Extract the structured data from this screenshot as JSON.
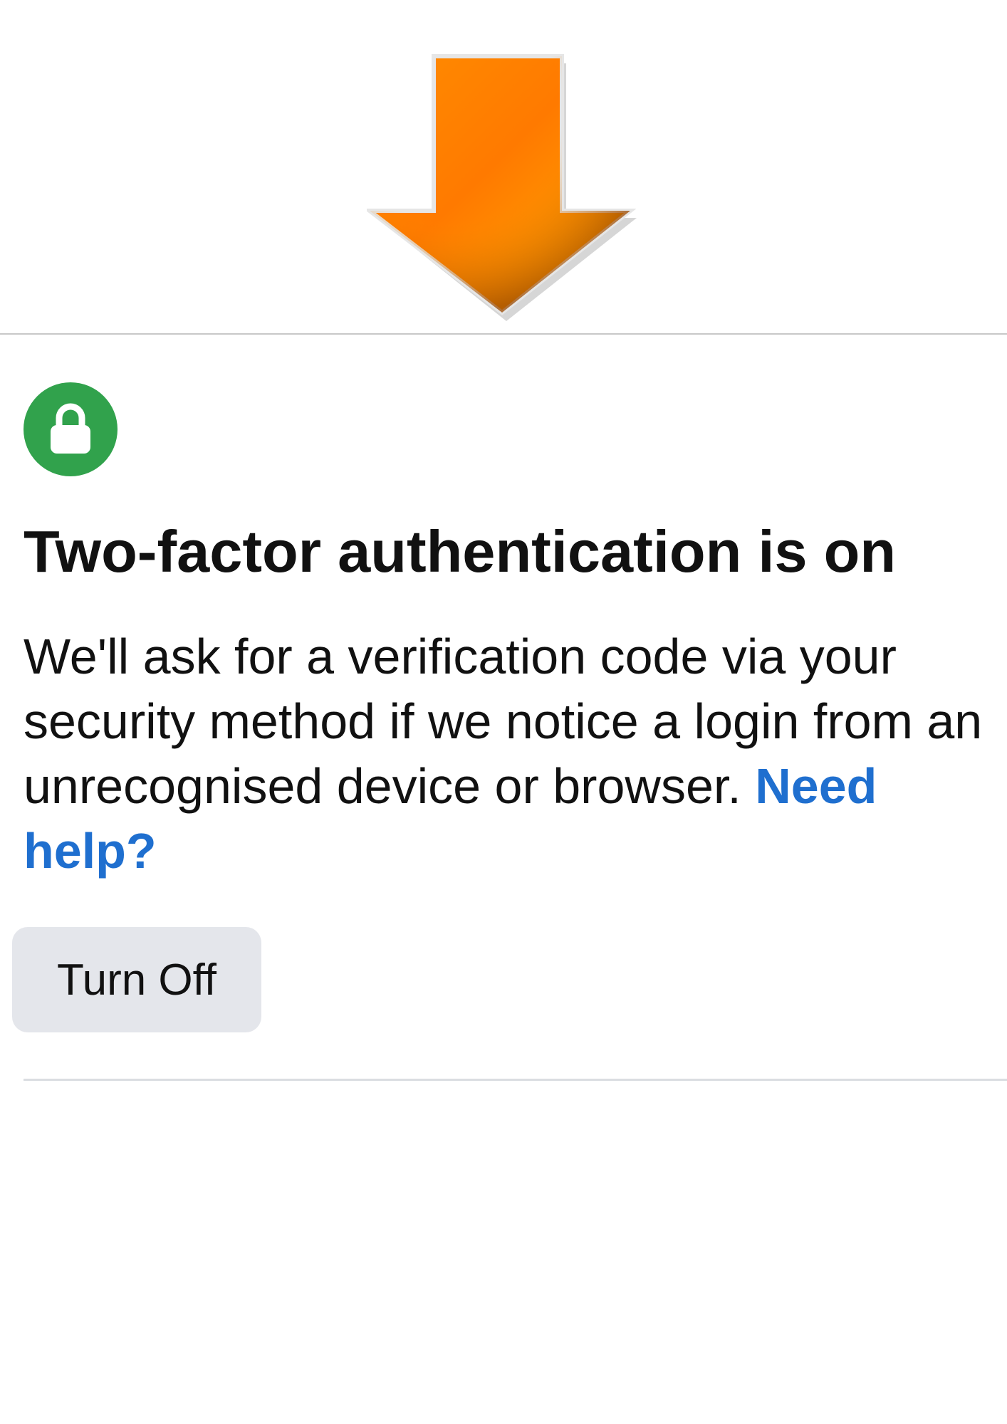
{
  "icons": {
    "pointer_arrow": "arrow-down-icon",
    "status_badge": "lock-icon"
  },
  "colors": {
    "arrow_light": "#ffb300",
    "arrow_mid": "#ff8a00",
    "arrow_dark": "#b85a00",
    "badge_green": "#31a24c",
    "link_blue": "#1f6fcf",
    "button_gray": "#e4e6eb"
  },
  "status": {
    "title": "Two-factor authentication is on",
    "description": "We'll ask for a verification code via your security method if we notice a login from an unrecognised device or browser.",
    "help_link": "Need help?"
  },
  "actions": {
    "turn_off_label": "Turn Off"
  }
}
